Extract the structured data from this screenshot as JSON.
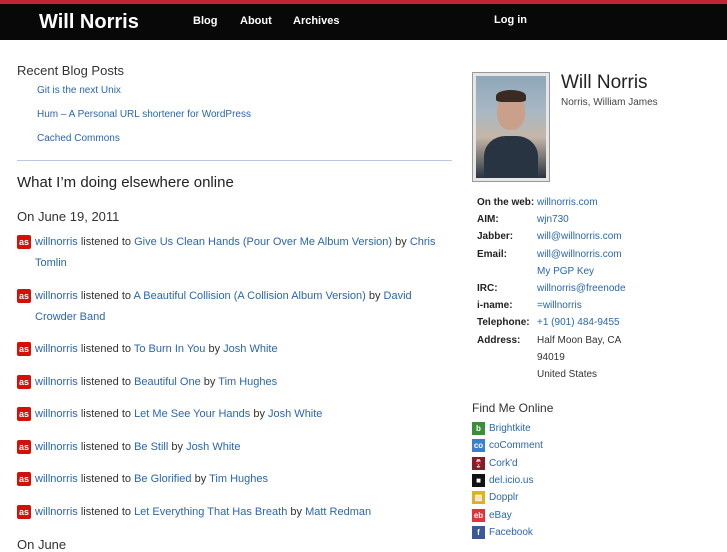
{
  "header": {
    "site_title": "Will Norris",
    "nav": [
      "Blog",
      "About",
      "Archives"
    ],
    "login": "Log in"
  },
  "recent": {
    "heading": "Recent Blog Posts",
    "posts": [
      "Git is the next Unix",
      "Hum – A Personal URL shortener for WordPress",
      "Cached Commons"
    ]
  },
  "elsewhere": {
    "heading": "What I’m doing elsewhere online",
    "date": "On June 19, 2011",
    "items": [
      {
        "user": "willnorris",
        "verb": "listened to",
        "track": "Give Us Clean Hands (Pour Over Me Album Version)",
        "by": "by",
        "artist": "Chris Tomlin"
      },
      {
        "user": "willnorris",
        "verb": "listened to",
        "track": "A Beautiful Collision (A Collision Album Version)",
        "by": "by",
        "artist": "David Crowder Band"
      },
      {
        "user": "willnorris",
        "verb": "listened to",
        "track": "To Burn In You",
        "by": "by",
        "artist": "Josh White"
      },
      {
        "user": "willnorris",
        "verb": "listened to",
        "track": "Beautiful One",
        "by": "by",
        "artist": "Tim Hughes"
      },
      {
        "user": "willnorris",
        "verb": "listened to",
        "track": "Let Me See Your Hands",
        "by": "by",
        "artist": "Josh White"
      },
      {
        "user": "willnorris",
        "verb": "listened to",
        "track": "Be Still",
        "by": "by",
        "artist": "Josh White"
      },
      {
        "user": "willnorris",
        "verb": "listened to",
        "track": "Be Glorified",
        "by": "by",
        "artist": "Tim Hughes"
      },
      {
        "user": "willnorris",
        "verb": "listened to",
        "track": "Let Everything That Has Breath",
        "by": "by",
        "artist": "Matt Redman"
      }
    ],
    "next_heading_partial": "On June"
  },
  "profile": {
    "name": "Will Norris",
    "full_name": "Norris, William James",
    "contact": [
      {
        "label": "On the web:",
        "values": [
          "willnorris.com"
        ],
        "link": true
      },
      {
        "label": "AIM:",
        "values": [
          "wjn730"
        ],
        "link": true
      },
      {
        "label": "Jabber:",
        "values": [
          "will@willnorris.com"
        ],
        "link": true
      },
      {
        "label": "Email:",
        "values": [
          "will@willnorris.com",
          "My PGP Key"
        ],
        "link": true
      },
      {
        "label": "IRC:",
        "values": [
          "willnorris@freenode"
        ],
        "link": true
      },
      {
        "label": "i-name:",
        "values": [
          "=willnorris"
        ],
        "link": true
      },
      {
        "label": "Telephone:",
        "values": [
          "+1 (901) 484-9455"
        ],
        "link": true
      },
      {
        "label": "Address:",
        "values": [
          "Half Moon Bay, CA",
          "94019",
          "United States"
        ],
        "link": false
      }
    ]
  },
  "find_online": {
    "heading": "Find Me Online",
    "services": [
      {
        "name": "Brightkite",
        "icon": "brightkite-icon",
        "color": "#3b8f3a",
        "glyph": "b"
      },
      {
        "name": "coComment",
        "icon": "cocomment-icon",
        "color": "#3a7fd0",
        "glyph": "co"
      },
      {
        "name": "Cork'd",
        "icon": "corkd-icon",
        "color": "#8a1a2a",
        "glyph": "🍷"
      },
      {
        "name": "del.icio.us",
        "icon": "delicious-icon",
        "color": "#111111",
        "glyph": "■"
      },
      {
        "name": "Dopplr",
        "icon": "dopplr-icon",
        "color": "#e0b020",
        "glyph": "▥"
      },
      {
        "name": "eBay",
        "icon": "ebay-icon",
        "color": "#e53238",
        "glyph": "eb"
      },
      {
        "name": "Facebook",
        "icon": "facebook-icon",
        "color": "#3b5998",
        "glyph": "f"
      }
    ]
  }
}
